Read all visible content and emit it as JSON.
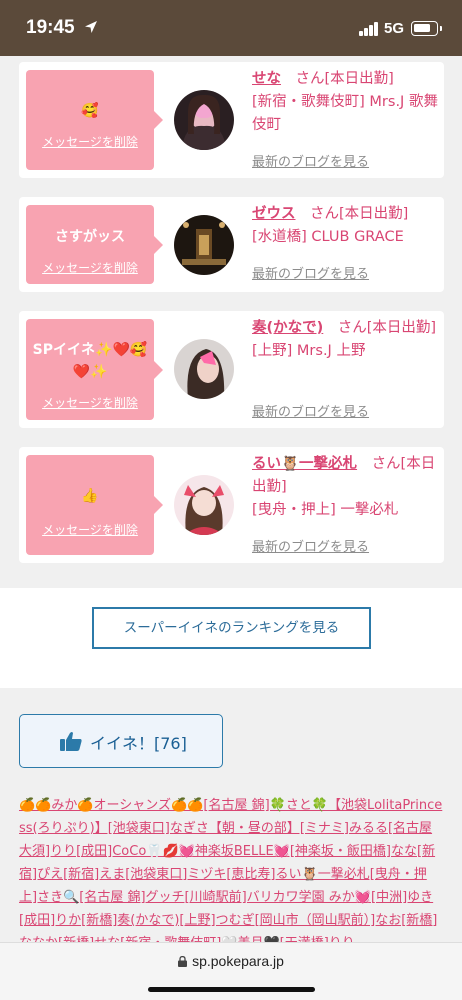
{
  "status_bar": {
    "time": "19:45",
    "network": "5G"
  },
  "cards": [
    {
      "message": "🥰",
      "delete_label": "メッセージを削除",
      "name": "せな",
      "san_suffix": "さん[本日出勤]",
      "shop": "[新宿・歌舞伎町] Mrs.J 歌舞伎町",
      "blog_label": "最新のブログを見る"
    },
    {
      "message": "さすがッス",
      "delete_label": "メッセージを削除",
      "name": "ゼウス",
      "san_suffix": "さん[本日出勤]",
      "shop": "[水道橋] CLUB GRACE",
      "blog_label": "最新のブログを見る"
    },
    {
      "message": "SPイイネ✨❤️🥰❤️✨",
      "delete_label": "メッセージを削除",
      "name": "奏(かなで)",
      "san_suffix": "さん[本日出勤]",
      "shop": "[上野] Mrs.J 上野",
      "blog_label": "最新のブログを見る"
    },
    {
      "message": "👍",
      "delete_label": "メッセージを削除",
      "name": "るい🦉一撃必札",
      "san_suffix": "さん[本日出勤]",
      "shop": "[曳舟・押上] 一撃必札",
      "blog_label": "最新のブログを見る"
    }
  ],
  "ranking_button": "スーパーイイネのランキングを見る",
  "like_button": "イイネ！[76]",
  "links_text": "🍊🍊みか🍊オーシャンズ🍊🍊[名古屋 錦]🍀さと🍀【池袋LolitaPrincess(ろりぷり)】[池袋東口]なぎさ【朝・昼の部】[ミナミ]みるる[名古屋 大須]りり[成田]CoCo🦷💋💓神楽坂BELLE💓[神楽坂・飯田橋]なな[新宿]ぴえ[新宿]えま[池袋東口]ミヅキ[恵比寿]るい🦉一撃必札[曳舟・押上]さき🔍[名古屋 錦]グッチ[川崎駅前]バリカワ学園 みか💓[中洲]ゆき[成田]りか[新橋]奏(かなで)[上野]つむぎ[岡山市（岡山駅前）]なお[新橋]ななか[新橋]せな[新宿・歌舞伎町]🤍美月🖤[天満橋]りり",
  "url": "sp.pokepara.jp",
  "colors": {
    "accent_pink": "#d94673",
    "bubble_pink": "#f8a3b1",
    "button_blue": "#2c7aa9",
    "status_bar": "#5b4a3a"
  }
}
